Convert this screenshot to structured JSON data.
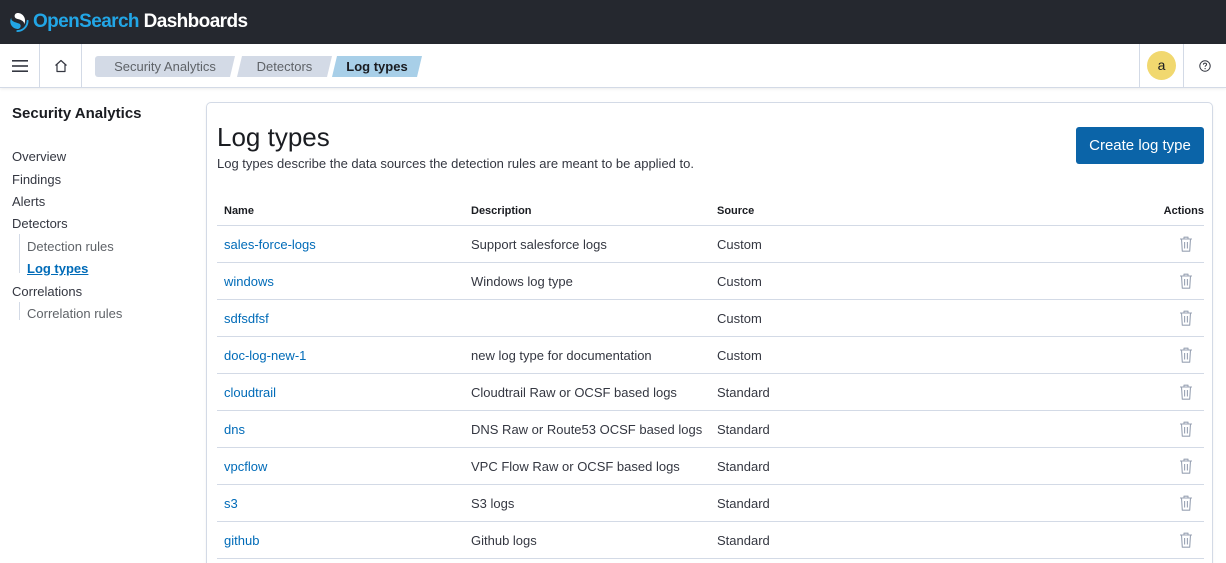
{
  "header": {
    "brand": "OpenSearch",
    "product": " Dashboards"
  },
  "topnav": {
    "breadcrumbs": [
      "Security Analytics",
      "Detectors",
      "Log types"
    ],
    "avatar_letter": "a"
  },
  "sidebar": {
    "title": "Security Analytics",
    "items": [
      {
        "label": "Overview"
      },
      {
        "label": "Findings"
      },
      {
        "label": "Alerts"
      },
      {
        "label": "Detectors"
      },
      {
        "label": "Detection rules"
      },
      {
        "label": "Log types"
      },
      {
        "label": "Correlations"
      },
      {
        "label": "Correlation rules"
      }
    ]
  },
  "main": {
    "title": "Log types",
    "description": "Log types describe the data sources the detection rules are meant to be applied to.",
    "create_button": "Create log type",
    "table": {
      "columns": [
        "Name",
        "Description",
        "Source",
        "Actions"
      ],
      "rows": [
        {
          "name": "sales-force-logs",
          "description": "Support salesforce logs",
          "source": "Custom"
        },
        {
          "name": "windows",
          "description": "Windows log type",
          "source": "Custom"
        },
        {
          "name": "sdfsdfsf",
          "description": "",
          "source": "Custom"
        },
        {
          "name": "doc-log-new-1",
          "description": "new log type for documentation",
          "source": "Custom"
        },
        {
          "name": "cloudtrail",
          "description": "Cloudtrail Raw or OCSF based logs",
          "source": "Standard"
        },
        {
          "name": "dns",
          "description": "DNS Raw or Route53 OCSF based logs",
          "source": "Standard"
        },
        {
          "name": "vpcflow",
          "description": "VPC Flow Raw or OCSF based logs",
          "source": "Standard"
        },
        {
          "name": "s3",
          "description": "S3 logs",
          "source": "Standard"
        },
        {
          "name": "github",
          "description": "Github logs",
          "source": "Standard"
        }
      ]
    }
  },
  "icons": {
    "logo": "opensearch-logo-icon",
    "menu": "hamburger-menu-icon",
    "home": "home-icon",
    "help": "help-icon",
    "delete": "trash-icon"
  },
  "colors": {
    "header_bg": "#25282f",
    "brand_blue": "#22a6e6",
    "link": "#006bb8",
    "primary_button": "#0b64a8",
    "crumb_active": "#a8cfe8",
    "crumb_inactive": "#d3dae6",
    "avatar": "#f1d86f"
  }
}
